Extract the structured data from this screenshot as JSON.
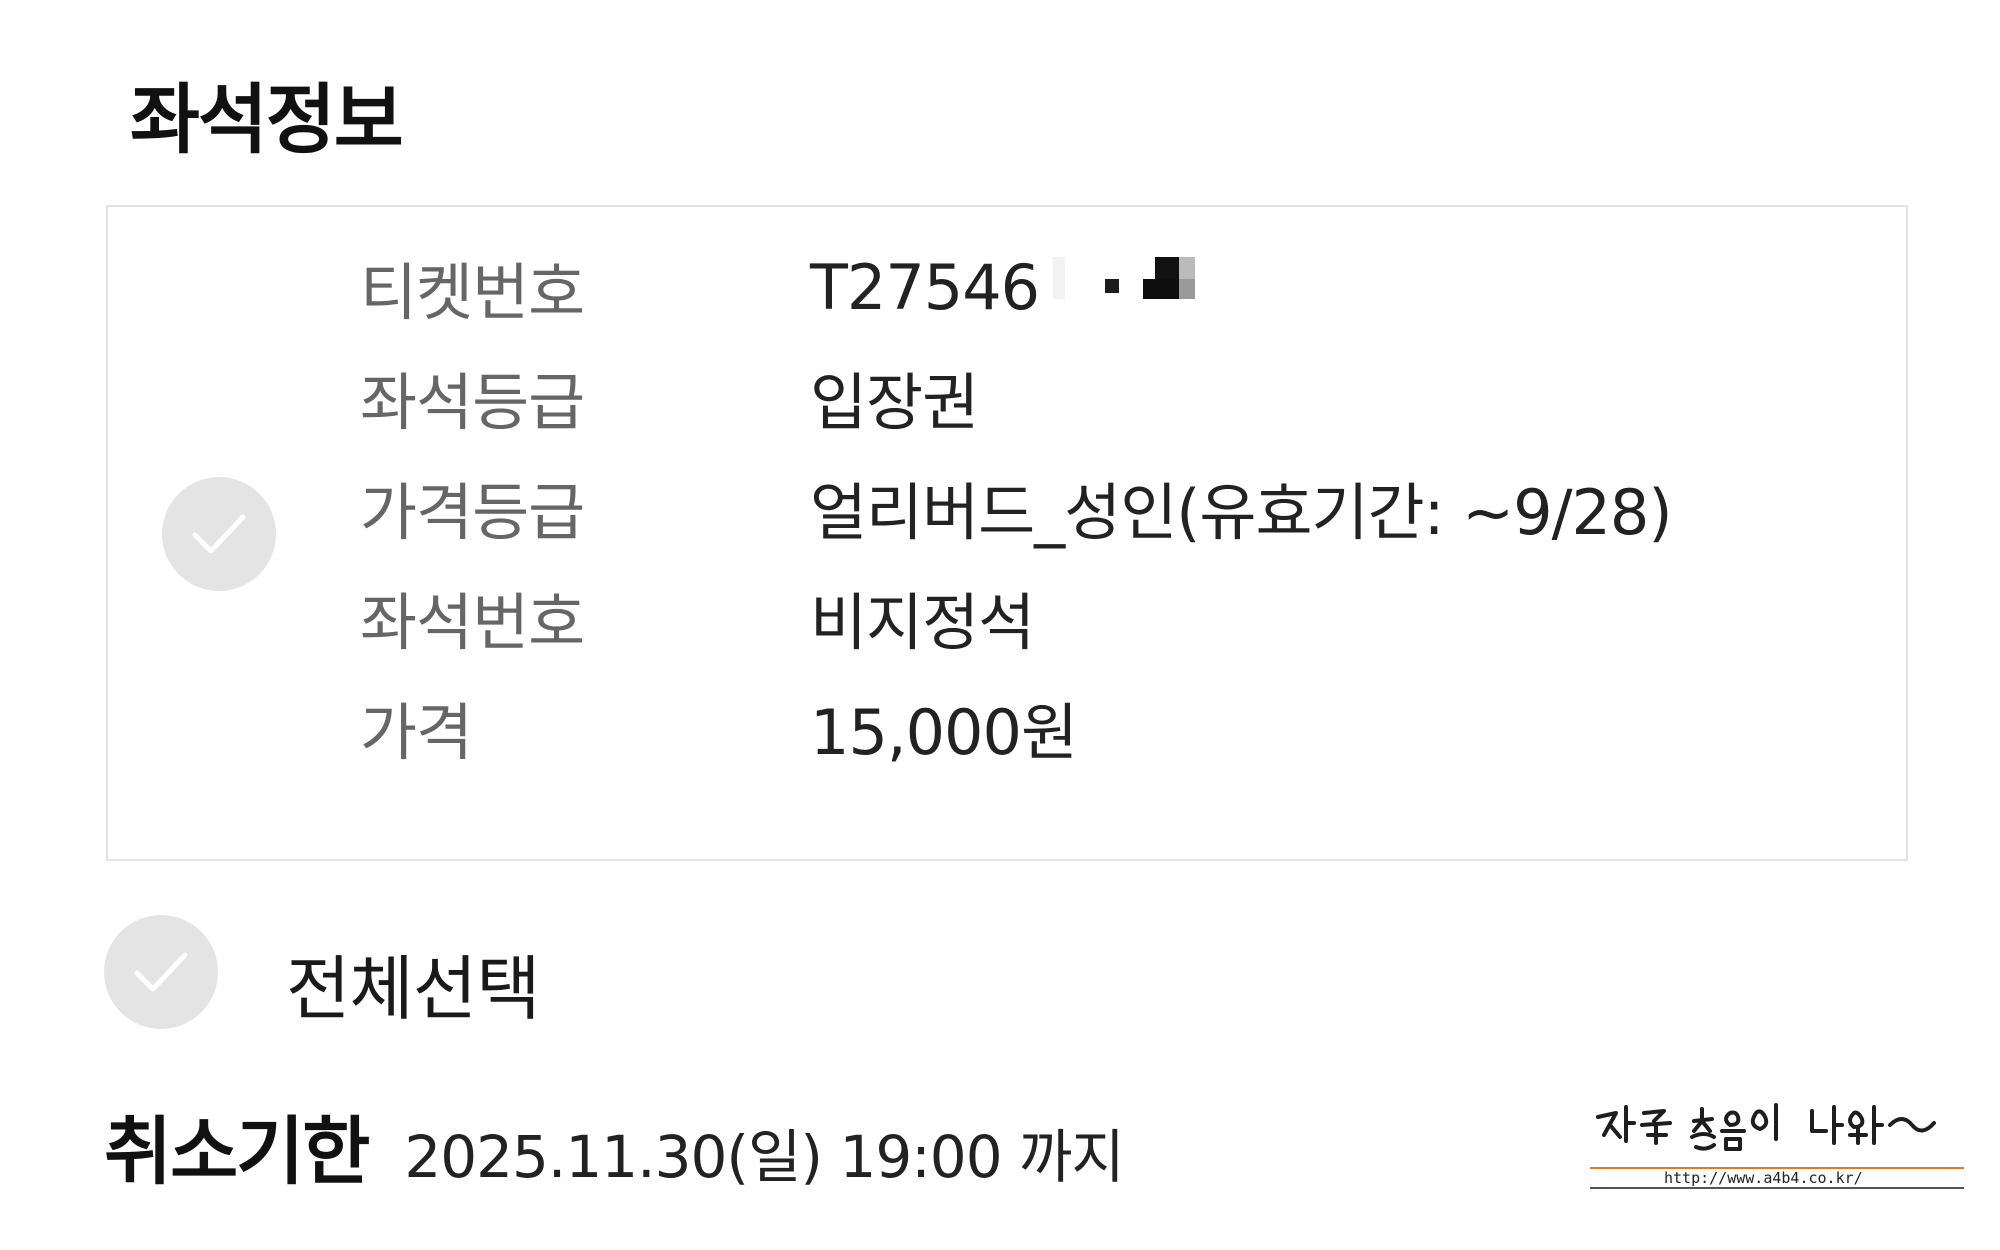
{
  "section": {
    "title": "좌석정보"
  },
  "seat_info": {
    "rows": [
      {
        "label": "티켓번호",
        "value": "T27546"
      },
      {
        "label": "좌석등급",
        "value": "입장권"
      },
      {
        "label": "가격등급",
        "value": "얼리버드_성인(유효기간: ~9/28)"
      },
      {
        "label": "좌석번호",
        "value": "비지정석"
      },
      {
        "label": "가격",
        "value": "15,000원"
      }
    ],
    "checked": false
  },
  "select_all": {
    "label": "전체선택",
    "checked": false
  },
  "cancel_deadline": {
    "label": "취소기한",
    "value": "2025.11.30(일) 19:00 까지"
  },
  "watermark": {
    "text": "자꾸 웃음이 나와~",
    "url": "http://www.a4b4.co.kr/"
  },
  "icons": {
    "checkbox": "check-icon",
    "checkbox_color": "#e4e4e4",
    "check_mark_color": "#ffffff"
  }
}
